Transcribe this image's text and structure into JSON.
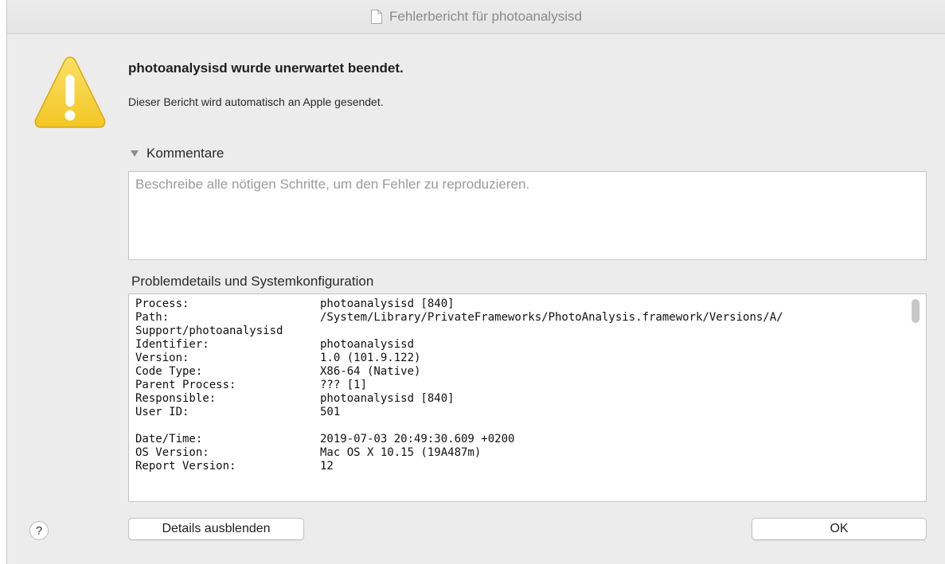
{
  "window": {
    "title": "Fehlerbericht für photoanalysisd"
  },
  "alert": {
    "headline": "photoanalysisd wurde unerwartet beendet.",
    "subtext": "Dieser Bericht wird automatisch an Apple gesendet.",
    "icon": "warning-icon",
    "icon_color": "#f7d44a"
  },
  "comments": {
    "label": "Kommentare",
    "expanded": true,
    "placeholder": "Beschreibe alle nötigen Schritte, um den Fehler zu reproduzieren.",
    "value": ""
  },
  "details": {
    "label": "Problemdetails und Systemkonfiguration",
    "rows": [
      {
        "key": "Process:",
        "value": "photoanalysisd [840]"
      },
      {
        "key": "Path:",
        "value": "/System/Library/PrivateFrameworks/PhotoAnalysis.framework/Versions/A/"
      },
      {
        "key": "Support/photoanalysisd",
        "value": ""
      },
      {
        "key": "Identifier:",
        "value": "photoanalysisd"
      },
      {
        "key": "Version:",
        "value": "1.0 (101.9.122)"
      },
      {
        "key": "Code Type:",
        "value": "X86-64 (Native)"
      },
      {
        "key": "Parent Process:",
        "value": "??? [1]"
      },
      {
        "key": "Responsible:",
        "value": "photoanalysisd [840]"
      },
      {
        "key": "User ID:",
        "value": "501"
      },
      {
        "key": "",
        "value": ""
      },
      {
        "key": "Date/Time:",
        "value": "2019-07-03 20:49:30.609 +0200"
      },
      {
        "key": "OS Version:",
        "value": "Mac OS X 10.15 (19A487m)"
      },
      {
        "key": "Report Version:",
        "value": "12"
      }
    ]
  },
  "buttons": {
    "help": "?",
    "details": "Details ausblenden",
    "ok": "OK"
  }
}
